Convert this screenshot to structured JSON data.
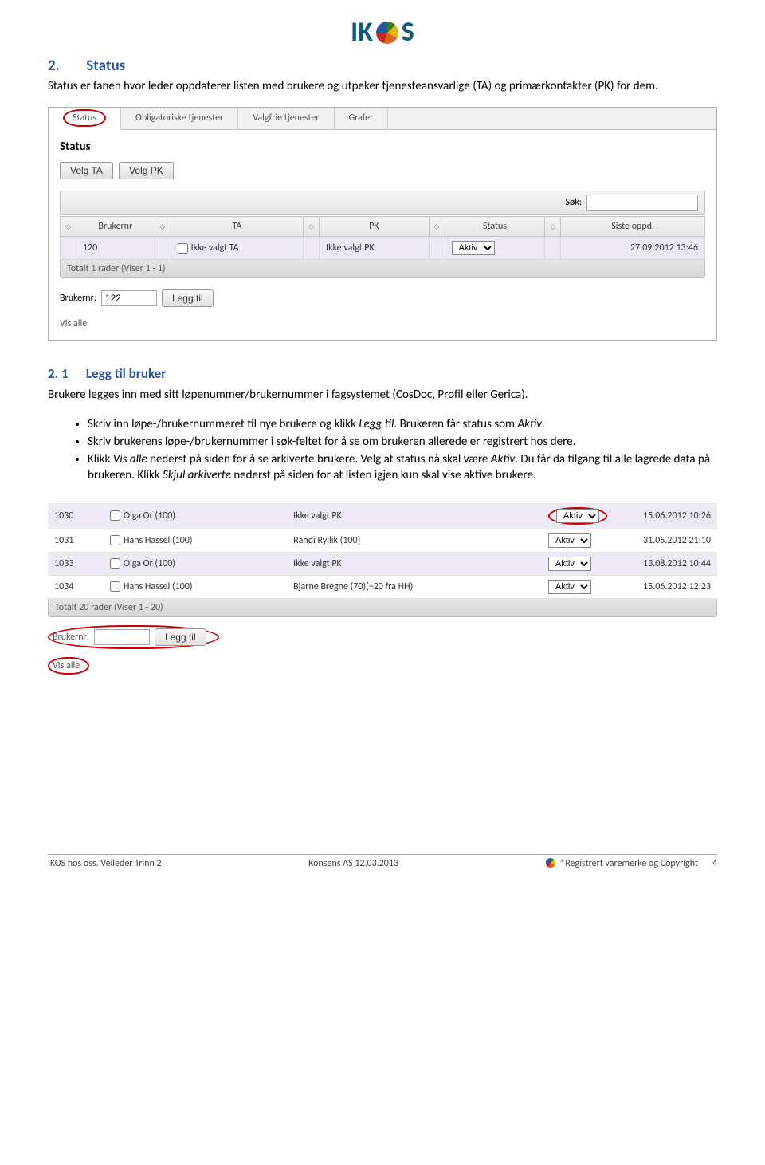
{
  "logo": {
    "pre": "IK",
    "post": "S"
  },
  "section": {
    "num": "2.",
    "title": "Status",
    "intro": "Status er fanen hvor leder oppdaterer listen med brukere og utpeker tjenesteansvarlige (TA) og primærkontakter (PK) for dem."
  },
  "screenshot1": {
    "tabs": [
      "Status",
      "Obligatoriske tjenester",
      "Valgfrie tjenester",
      "Grafer"
    ],
    "active_tab": 0,
    "panel_title": "Status",
    "buttons": {
      "velg_ta": "Velg TA",
      "velg_pk": "Velg PK"
    },
    "search_label": "Søk:",
    "columns": [
      "Brukernr",
      "TA",
      "PK",
      "Status",
      "Siste oppd."
    ],
    "row": {
      "brukernr": "120",
      "ta": "Ikke valgt TA",
      "pk": "Ikke valgt PK",
      "status": "Aktiv",
      "siste": "27.09.2012 13:46"
    },
    "totalt": "Totalt 1 rader (Viser 1 - 1)",
    "add": {
      "label": "Brukernr:",
      "value": "122",
      "btn": "Legg til"
    },
    "visalle": "Vis alle"
  },
  "subsection": {
    "num": "2. 1",
    "title": "Legg til bruker",
    "intro": "Brukere legges inn med sitt løpenummer/brukernummer i fagsystemet (CosDoc, Profil eller Gerica).",
    "bullets": [
      {
        "pre": "Skriv inn løpe-/brukernummeret til nye brukere og klikk ",
        "i1": "Legg til",
        "mid": ". Brukeren får status som ",
        "i2": "Aktiv",
        "post": "."
      },
      {
        "pre": "Skriv brukerens løpe-/brukernummer i søk-feltet for å se om brukeren allerede er registrert hos dere."
      },
      {
        "pre": "Klikk ",
        "i1": "Vis alle",
        "mid": " nederst på siden for å se arkiverte brukere. Velg at status nå skal være ",
        "i2": "Aktiv",
        "mid2": ". Du får da tilgang til alle lagrede data på brukeren. Klikk ",
        "i3": "Skjul arkiverte",
        "post": " nederst på siden for at listen igjen kun skal vise aktive brukere."
      }
    ]
  },
  "screenshot2": {
    "rows": [
      {
        "nr": "1030",
        "ta": "Olga Or (100)",
        "pk": "Ikke valgt PK",
        "status": "Aktiv",
        "dt": "15.06.2012 10:26",
        "circled": true
      },
      {
        "nr": "1031",
        "ta": "Hans Hassel (100)",
        "pk": "Randi Ryllik (100)",
        "status": "Aktiv",
        "dt": "31.05.2012 21:10"
      },
      {
        "nr": "1033",
        "ta": "Olga Or (100)",
        "pk": "Ikke valgt PK",
        "status": "Aktiv",
        "dt": "13.08.2012 10:44"
      },
      {
        "nr": "1034",
        "ta": "Hans Hassel (100)",
        "pk": "Bjarne Bregne (70)(+20 fra HH)",
        "status": "Aktiv",
        "dt": "15.06.2012 12:23"
      }
    ],
    "totalt": "Totalt 20 rader (Viser 1 - 20)",
    "add": {
      "label": "Brukernr:",
      "btn": "Legg til"
    },
    "visalle": "Vis alle"
  },
  "footer": {
    "left": "IKOS hos oss. Veileder Trinn 2",
    "center": "Konsens AS 12.03.2013",
    "right": "®Registrert varemerke og Copyright",
    "page": "4"
  }
}
